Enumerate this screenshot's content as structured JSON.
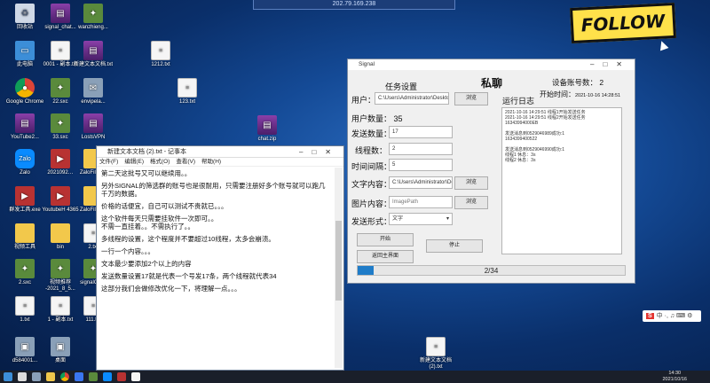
{
  "remote_session": {
    "title": "202.79.169.238"
  },
  "follow_badge": "FOLLOW",
  "desktop_icons": [
    {
      "label": "回收站",
      "icon": "recycle-bin-icon",
      "cls": "bin",
      "glyph": "♻"
    },
    {
      "label": "signal_chat...",
      "icon": "zip-archive-icon",
      "cls": "zip",
      "glyph": "▤"
    },
    {
      "label": "wanzhieng...",
      "icon": "app-icon",
      "cls": "app",
      "glyph": "✦"
    },
    {
      "label": "此电脑",
      "icon": "computer-icon",
      "cls": "pc",
      "glyph": "▭"
    },
    {
      "label": "0001 - 副本.txt",
      "icon": "text-file-icon",
      "cls": "doc",
      "glyph": "≡"
    },
    {
      "label": "新建文本文档.txt",
      "icon": "zip-archive-icon",
      "cls": "zip",
      "glyph": "▤"
    },
    {
      "label": "Google Chrome",
      "icon": "chrome-icon",
      "cls": "chrome",
      "glyph": "●"
    },
    {
      "label": "22.sxc",
      "icon": "app-icon",
      "cls": "app",
      "glyph": "✦"
    },
    {
      "label": "envipela...",
      "icon": "app-icon",
      "cls": "img",
      "glyph": "✉"
    },
    {
      "label": "YouTube2...",
      "icon": "zip-archive-icon",
      "cls": "zip",
      "glyph": "▤"
    },
    {
      "label": "33.sxc",
      "icon": "app-icon",
      "cls": "app",
      "glyph": "✦"
    },
    {
      "label": "LostsVPN",
      "icon": "zip-archive-icon",
      "cls": "zip",
      "glyph": "▤"
    },
    {
      "label": "Zalo",
      "icon": "zalo-icon",
      "cls": "zalo",
      "glyph": "Zalo"
    },
    {
      "label": "2021092…",
      "icon": "video-file-icon",
      "cls": "vid",
      "glyph": "▶"
    },
    {
      "label": "ZaloFiles…",
      "icon": "folder-icon",
      "cls": "folder",
      "glyph": ""
    },
    {
      "label": "群发工具.exe",
      "icon": "app-icon",
      "cls": "vid",
      "glyph": "▶"
    },
    {
      "label": "YoutubeH 4365",
      "icon": "app-icon",
      "cls": "vid",
      "glyph": "▶"
    },
    {
      "label": "ZaloFiles…",
      "icon": "folder-icon",
      "cls": "folder",
      "glyph": ""
    },
    {
      "label": "视频工具",
      "icon": "folder-icon",
      "cls": "folder",
      "glyph": ""
    },
    {
      "label": "bin",
      "icon": "folder-icon",
      "cls": "folder",
      "glyph": ""
    },
    {
      "label": "2.txt",
      "icon": "text-file-icon",
      "cls": "doc",
      "glyph": "≡"
    },
    {
      "label": "2.sxc",
      "icon": "app-icon",
      "cls": "app",
      "glyph": "✦"
    },
    {
      "label": "视频推荐 -2021_8_5...",
      "icon": "app-icon",
      "cls": "app",
      "glyph": "✦"
    },
    {
      "label": "signalCle...",
      "icon": "app-icon",
      "cls": "app",
      "glyph": "✦"
    },
    {
      "label": "1.txt",
      "icon": "text-file-icon",
      "cls": "doc",
      "glyph": "≡"
    },
    {
      "label": "1 - 副本.txt",
      "icon": "text-file-icon",
      "cls": "doc",
      "glyph": "≡"
    },
    {
      "label": "111.txt",
      "icon": "text-file-icon",
      "cls": "doc",
      "glyph": "≡"
    },
    {
      "label": "3.txt",
      "icon": "text-file-icon",
      "cls": "doc",
      "glyph": "≡"
    },
    {
      "label": "d584001...",
      "icon": "image-file-icon",
      "cls": "img",
      "glyph": "▣"
    },
    {
      "label": "桌面",
      "icon": "folder-icon",
      "cls": "img",
      "glyph": "▣"
    },
    {
      "label": "1212.txt",
      "icon": "text-file-icon",
      "cls": "doc",
      "glyph": "≡"
    },
    {
      "label": "123.txt",
      "icon": "text-file-icon",
      "cls": "doc",
      "glyph": "≡"
    },
    {
      "label": "chat.zip",
      "icon": "zip-archive-icon",
      "cls": "zip",
      "glyph": "▤"
    },
    {
      "label": "新建文本文档 (2).txt",
      "icon": "text-file-icon",
      "cls": "doc",
      "glyph": "≡"
    }
  ],
  "notepad": {
    "title": "新建文本文档 (2).txt - 记事本",
    "menu": [
      "文件(F)",
      "编辑(E)",
      "格式(O)",
      "查看(V)",
      "帮助(H)"
    ],
    "lines": [
      "第二天这批号又可以继续用。。",
      "另外SIGNAL的筛选群的账号也是很耐用，只需要注册好多个账号就可以跑几千万的数据。",
      "价格的话便宜，自己可以测试不贵就已。。。",
      "这个软件每天只需要挂软件一次即可。。\n不需一直挂着。。不需执行了。。",
      "多线程的设置，这个程度并不要超过10线程，太多会崩溃。",
      "一行一个内容。。。",
      "文本最少要添加2个以上的内容",
      "发送数量设置17就是代表一个号发17条，两个线程就代表34",
      "这部分我们会做修改优化一下，将理解一点。。。"
    ]
  },
  "signal": {
    "window_title": "Signal",
    "task_settings": "任务设置",
    "app_name": "私聊",
    "device_count_label": "设备账号数：",
    "device_count": "2",
    "start_time_label": "开始时间：",
    "start_time": "2021-10-16 14:28:51",
    "user_label": "用户：",
    "user_path": "C:\\Users\\Administrator\\Desktop\\C",
    "browse_label": "浏览",
    "user_count_label": "用户数量：",
    "user_count": "35",
    "send_count_label": "发送数量：",
    "send_count": "17",
    "threads_label": "线程数：",
    "threads": "2",
    "interval_label": "时间间隔：",
    "interval": "5",
    "text_label": "文字内容：",
    "text_path": "C:\\Users\\Administrator\\Deskt",
    "image_label": "图片内容：",
    "image_placeholder": "ImagePath",
    "mode_label": "发送形式：",
    "mode_value": "文字",
    "start_button": "开始",
    "stop_button": "停止",
    "back_button": "返回主界面",
    "log_title": "运行日志",
    "log_entries": [
      [
        "2021-10-16 14:29:51   线程1开始发送任务",
        "2021-10-16 14:29:51   线程2开始发送任务",
        "16343994000EB"
      ],
      [
        "发送消息到0529046989成功:1",
        "1634399400522"
      ],
      [
        "发送消息到0529046990成功:1",
        "线程1 休息：3s",
        "线程2 休息：3s"
      ]
    ],
    "progress_text": "2/34",
    "progress_value": 0.059
  },
  "ime": {
    "logo": "S",
    "label": "中 ·, ♫ ⌨ ⚙"
  },
  "tray": {
    "time": "14:30",
    "date": "2021/10/16"
  }
}
